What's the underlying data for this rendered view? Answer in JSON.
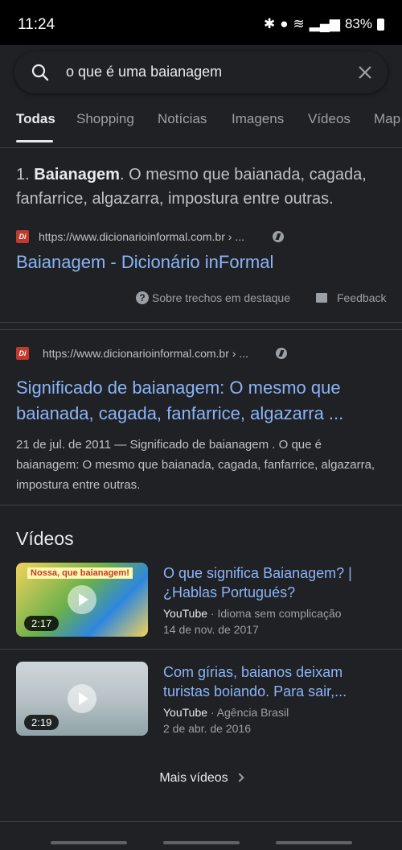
{
  "status": {
    "time": "11:24",
    "battery": "83%"
  },
  "search": {
    "query": "o que é uma baianagem"
  },
  "tabs": [
    {
      "label": "Todas",
      "active": true
    },
    {
      "label": "Shopping"
    },
    {
      "label": "Notícias"
    },
    {
      "label": "Imagens"
    },
    {
      "label": "Vídeos"
    },
    {
      "label": "Map"
    }
  ],
  "featured": {
    "number": "1. ",
    "term": "Baianagem",
    "text": ". O mesmo que baianada, cagada, fanfarrice, algazarra, impostura entre outras.",
    "favicon_text": "Di",
    "url": "https://www.dicionarioinformal.com.br › ...",
    "title": "Baianagem - Dicionário inFormal",
    "about_label": "Sobre trechos em destaque",
    "feedback_label": "Feedback"
  },
  "result2": {
    "favicon_text": "Di",
    "url": "https://www.dicionarioinformal.com.br › ...",
    "title": "Significado de baianagem: O mesmo que baianada, cagada, fanfarrice, algazarra ...",
    "description": "21 de jul. de 2011 — Significado de baianagem . O que é baianagem: O mesmo que baianada, cagada, fanfarrice, algazarra, impostura entre outras."
  },
  "videos": {
    "heading": "Vídeos",
    "items": [
      {
        "title": "O que significa Baianagem? | ¿Hablas Portugués?",
        "source": "YouTube",
        "channel": " · Idioma sem complicação",
        "date": "14 de nov. de 2017",
        "duration": "2:17",
        "thumb_caption": "Nossa, que baianagem!"
      },
      {
        "title": "Com gírias, baianos deixam turistas boiando. Para sair,...",
        "source": "YouTube",
        "channel": " · Agência Brasil",
        "date": "2 de abr. de 2016",
        "duration": "2:19"
      }
    ],
    "more_label": "Mais vídeos"
  },
  "colors": {
    "link": "#8ab4f8",
    "background": "#202124",
    "favicon": "#c0392b"
  }
}
